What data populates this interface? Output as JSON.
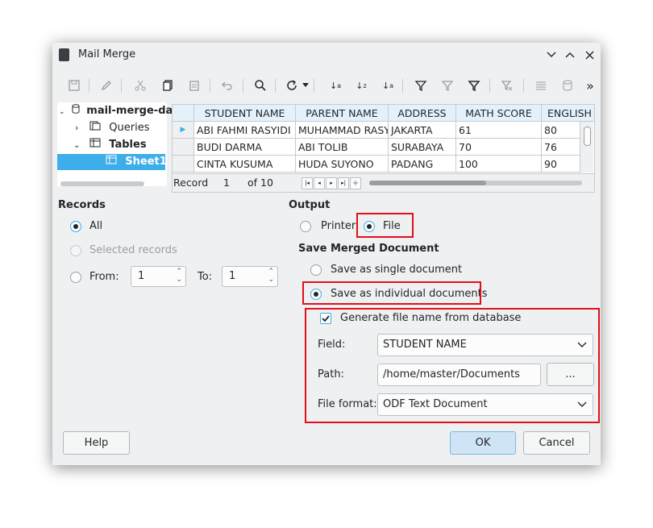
{
  "window": {
    "title": "Mail Merge"
  },
  "tree": {
    "root": "mail-merge-da",
    "queries": "Queries",
    "tables": "Tables",
    "sheet": "Sheet1"
  },
  "grid": {
    "columns": [
      "STUDENT NAME",
      "PARENT NAME",
      "ADDRESS",
      "MATH SCORE",
      "ENGLISH"
    ],
    "rows": [
      [
        "ABI FAHMI RASYIDI",
        "MUHAMMAD RASY",
        "JAKARTA",
        "61",
        "80"
      ],
      [
        "BUDI DARMA",
        "ABI TOLIB",
        "SURABAYA",
        "70",
        "76"
      ],
      [
        "CINTA KUSUMA",
        "HUDA SUYONO",
        "PADANG",
        "100",
        "90"
      ]
    ],
    "record_label": "Record",
    "record_current": "1",
    "record_total": "of 10"
  },
  "records": {
    "heading": "Records",
    "all": "All",
    "selected": "Selected records",
    "from_label": "From:",
    "from_value": "1",
    "to_label": "To:",
    "to_value": "1"
  },
  "output": {
    "heading": "Output",
    "printer": "Printer",
    "file": "File",
    "save_heading": "Save Merged Document",
    "single": "Save as single document",
    "individual": "Save as individual documents",
    "generate": "Generate file name from database",
    "field_label": "Field:",
    "field_value": "STUDENT NAME",
    "path_label": "Path:",
    "path_value": "/home/master/Documents",
    "browse": "...",
    "format_label": "File format:",
    "format_value": "ODF Text Document"
  },
  "buttons": {
    "help": "Help",
    "ok": "OK",
    "cancel": "Cancel"
  },
  "colors": {
    "highlight": "#e0101a",
    "selection": "#3daee9"
  }
}
